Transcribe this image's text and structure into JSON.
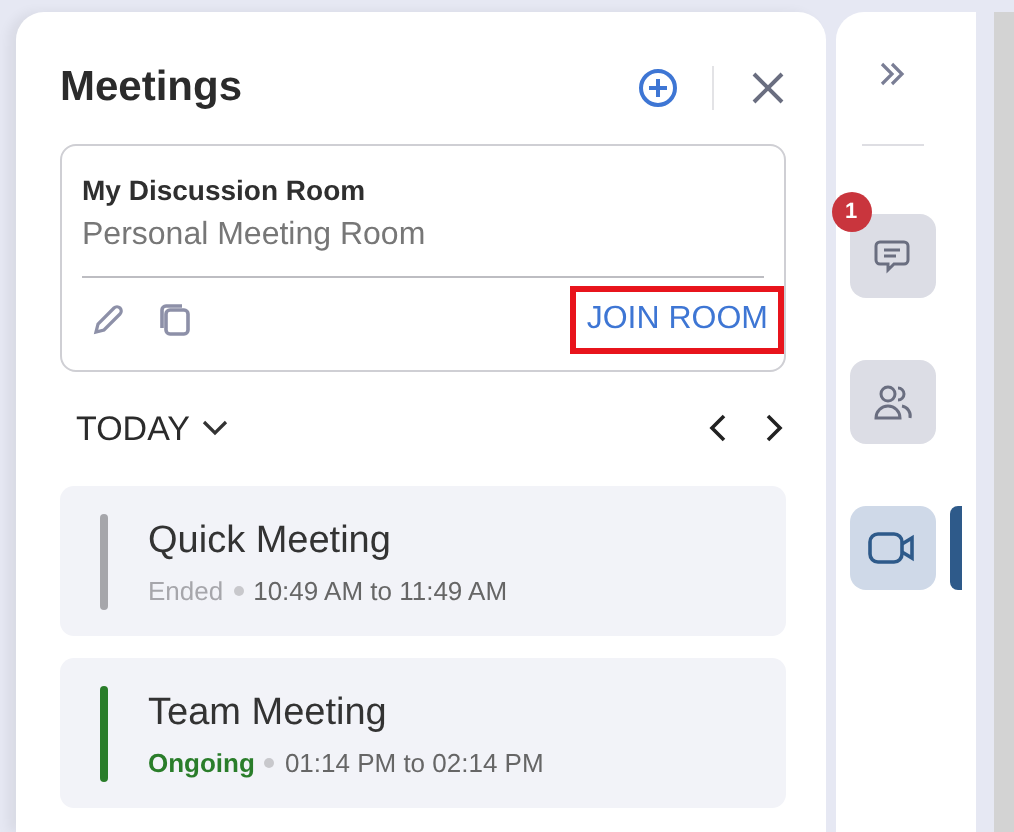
{
  "panel": {
    "title": "Meetings"
  },
  "room": {
    "name": "My Discussion Room",
    "subtitle": "Personal Meeting Room",
    "join_label": "JOIN ROOM",
    "highlighted": true
  },
  "day": {
    "label": "TODAY"
  },
  "meetings": [
    {
      "title": "Quick Meeting",
      "status": "Ended",
      "kind": "ended",
      "color": "#a6a6ab",
      "time": "10:49 AM to 11:49 AM"
    },
    {
      "title": "Team Meeting",
      "status": "Ongoing",
      "kind": "ongoing",
      "color": "#2a7d2a",
      "time": "01:14 PM to 02:14 PM"
    }
  ],
  "rail": {
    "items": [
      {
        "kind": "chat",
        "badge": "1",
        "selected": false
      },
      {
        "kind": "people",
        "selected": false
      },
      {
        "kind": "video",
        "selected": true
      }
    ]
  }
}
